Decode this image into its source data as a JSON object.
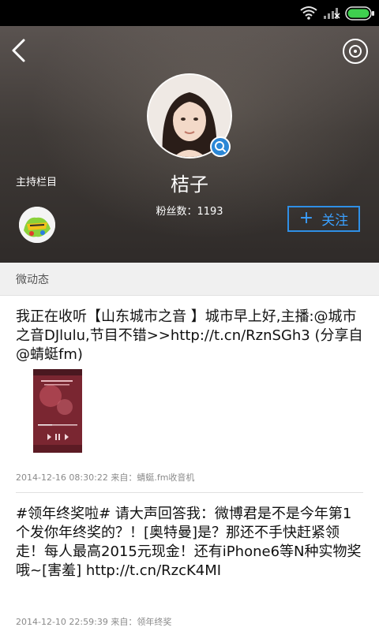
{
  "status_bar": {
    "icons": [
      "wifi-icon",
      "signal-icon",
      "battery-icon"
    ]
  },
  "header": {
    "back_icon": "chevron-left-icon",
    "disc_icon": "disc-icon",
    "host_columns_label": "主持栏目",
    "name": "桔子",
    "fans": "粉丝数：1193",
    "follow_label": "关注",
    "follow_icon": "plus-icon",
    "accent_color": "#2f8fe6"
  },
  "section": {
    "title": "微动态"
  },
  "posts": [
    {
      "text": "我正在收听【山东城市之音 】城市早上好,主播:@城市之音DJlulu,节目不错>>http://t.cn/RznSGh3 (分享自@蜻蜓fm)",
      "meta": "2014-12-16 08:30:22  来自：蜻蜓.fm收音机",
      "has_image": true
    },
    {
      "text": "#领年终奖啦# 请大声回答我：微博君是不是今年第1个发你年终奖的？！[奥特曼]是？那还不手快赶紧领走！每人最高2015元现金！还有iPhone6等N种实物奖哦~[害羞] http://t.cn/RzcK4MI",
      "meta": "2014-12-10 22:59:39  来自：领年终奖"
    }
  ]
}
